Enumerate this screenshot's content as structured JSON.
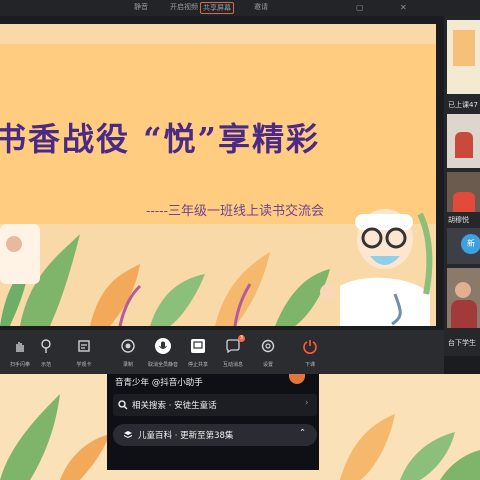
{
  "top_tabs": [
    "静音",
    "开启视频",
    "共享屏幕",
    "邀请"
  ],
  "slide": {
    "title": "书香战役 “悦”享精彩",
    "subtitle": "-----三年级一班线上读书交流会"
  },
  "participants_panel": {
    "count_label": "已上课47",
    "name_label": "胡穆悦",
    "badge_label": "新",
    "footer_label": "台下学生"
  },
  "toolbar": {
    "items": [
      {
        "label": "扫手闪拳",
        "icon": "hand-icon"
      },
      {
        "label": "示范",
        "icon": "pin-icon"
      },
      {
        "label": "学观卡",
        "icon": "card-icon"
      },
      {
        "label": "录制",
        "icon": "record-icon"
      },
      {
        "label": "取消全员静音",
        "icon": "mic-icon"
      },
      {
        "label": "停止共享",
        "icon": "screen-icon"
      },
      {
        "label": "互动消息",
        "icon": "chat-icon",
        "badge": "3"
      },
      {
        "label": "设置",
        "icon": "gear-icon"
      },
      {
        "label": "下课",
        "icon": "power-icon"
      }
    ],
    "accent": "#ff5a3c"
  },
  "douyin_panel": {
    "line1": "音青少年 @抖音小助手",
    "search_label": "相关搜索 · 安徒生童话",
    "series_label": "儿童百科 · 更新至第38集"
  }
}
